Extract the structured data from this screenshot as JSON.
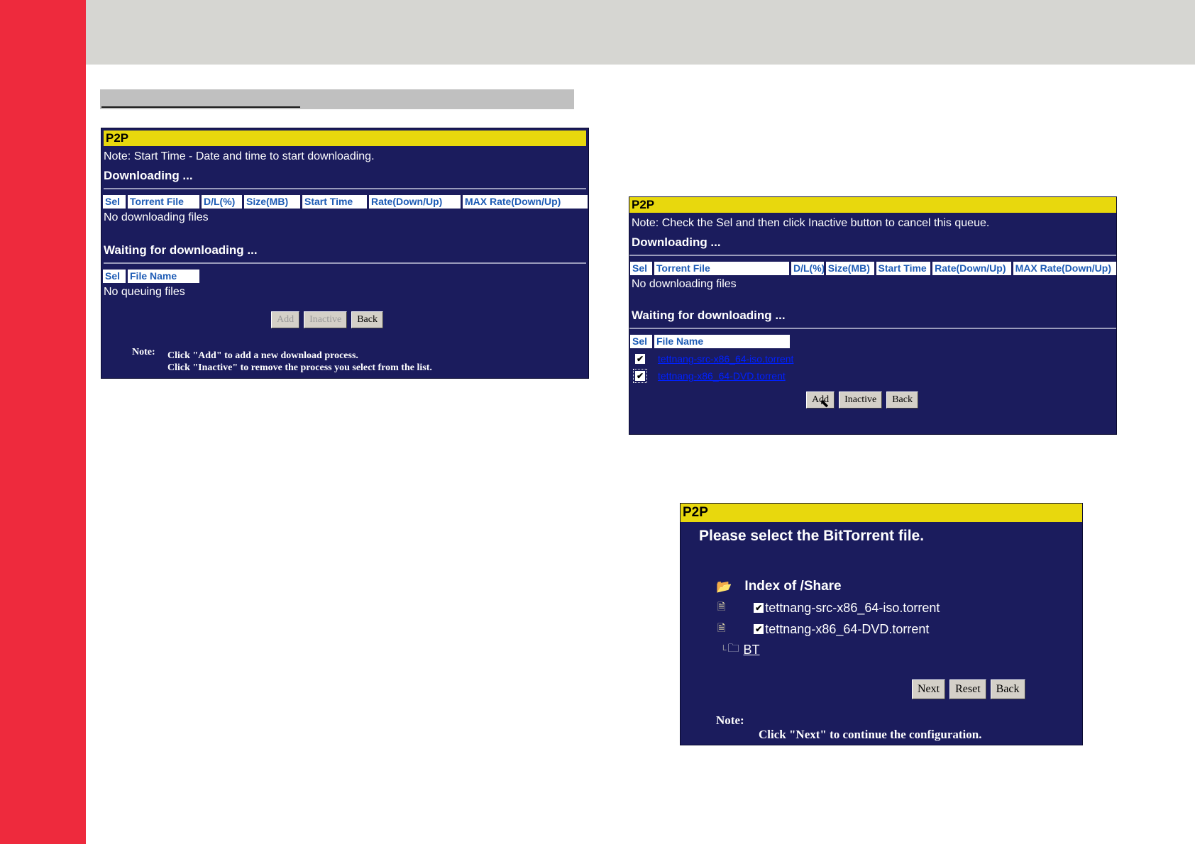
{
  "panel1": {
    "title": "P2P",
    "note": "Note: Start Time - Date and time to start downloading.",
    "downloading_heading": "Downloading ...",
    "columns": [
      "Sel",
      "Torrent File",
      "D/L(%)",
      "Size(MB)",
      "Start Time",
      "Rate(Down/Up)",
      "MAX Rate(Down/Up)"
    ],
    "no_downloading": "No downloading files",
    "waiting_heading": "Waiting for downloading ...",
    "queue_columns": [
      "Sel",
      "File Name"
    ],
    "no_queuing": "No queuing files",
    "buttons": {
      "add": "Add",
      "inactive": "Inactive",
      "back": "Back"
    },
    "note_label": "Note:",
    "note_line1": "Click \"Add\" to add a new download process.",
    "note_line2": "Click \"Inactive\" to remove the process you select from the list."
  },
  "panel2": {
    "title": "P2P",
    "note": "Note: Check the Sel and then click Inactive button to cancel this queue.",
    "downloading_heading": "Downloading ...",
    "columns": [
      "Sel",
      "Torrent File",
      "D/L(%)",
      "Size(MB)",
      "Start Time",
      "Rate(Down/Up)",
      "MAX Rate(Down/Up)"
    ],
    "no_downloading": "No downloading files",
    "waiting_heading": "Waiting for downloading ...",
    "queue_columns": [
      "Sel",
      "File Name"
    ],
    "buttons": {
      "add": "Add",
      "inactive": "Inactive",
      "back": "Back"
    }
  },
  "panel3": {
    "title": "P2P",
    "heading": "Please select the BitTorrent file.",
    "index_label": "Index of /Share",
    "files": [
      "tettnang-src-x86_64-iso.torrent",
      "tettnang-x86_64-DVD.torrent"
    ],
    "folder": "BT",
    "buttons": {
      "next": "Next",
      "reset": "Reset",
      "back": "Back"
    },
    "note_label": "Note:",
    "note_text": "Click \"Next\" to continue the configuration."
  },
  "colors": {
    "accent_red": "#ee2a3d",
    "panel_navy": "#1b1c5d",
    "title_yellow": "#e8d80d",
    "header_blue": "#1d5bb5"
  }
}
